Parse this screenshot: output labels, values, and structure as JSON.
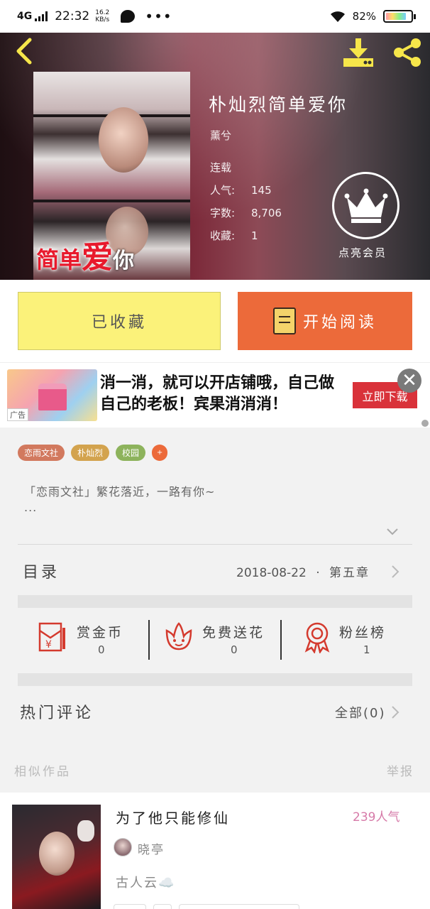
{
  "status_bar": {
    "network": "4G",
    "time": "22:32",
    "speed_value": "16.2",
    "speed_unit": "KB/s",
    "more": "•••",
    "battery": "82%"
  },
  "book": {
    "title": "朴灿烈简单爱你",
    "author": "薰兮",
    "status": "连载",
    "meta": [
      {
        "key": "人气:",
        "value": "145"
      },
      {
        "key": "字数:",
        "value": "8,706"
      },
      {
        "key": "收藏:",
        "value": "1"
      }
    ],
    "cover_text": "简单",
    "cover_text_big": "爱",
    "cover_text_small": "你",
    "vip_label": "点亮会员"
  },
  "actions": {
    "favorited_label": "已收藏",
    "read_label": "开始阅读"
  },
  "ad": {
    "text": "消一消，就可以开店铺哦，自己做自己的老板！宾果消消消！",
    "tag": "广告",
    "cta": "立即下载",
    "close": "✕"
  },
  "tags": [
    {
      "label": "恋雨文社",
      "color": "#d2795e"
    },
    {
      "label": "朴灿烈",
      "color": "#d3a34e"
    },
    {
      "label": "校园",
      "color": "#8db35c"
    },
    {
      "label": "+",
      "color": "#ec6a3a"
    }
  ],
  "intro": {
    "line1": "「恋雨文社」繁花落近，一路有你~",
    "line2": "..."
  },
  "toc": {
    "label": "目录",
    "date": "2018-08-22",
    "separator": "·",
    "chapter": "第五章"
  },
  "stats": [
    {
      "label": "赏金币",
      "value": "0",
      "icon": "red-envelope-icon"
    },
    {
      "label": "免费送花",
      "value": "0",
      "icon": "flower-icon"
    },
    {
      "label": "粉丝榜",
      "value": "1",
      "icon": "medal-icon"
    }
  ],
  "comments": {
    "label": "热门评论",
    "all": "全部(0)"
  },
  "similar": {
    "heading": "相似作品",
    "report": "举报",
    "item": {
      "title": "为了他只能修仙",
      "popularity": "239人气",
      "author": "晓亭",
      "desc": "古人云☁️"
    }
  }
}
